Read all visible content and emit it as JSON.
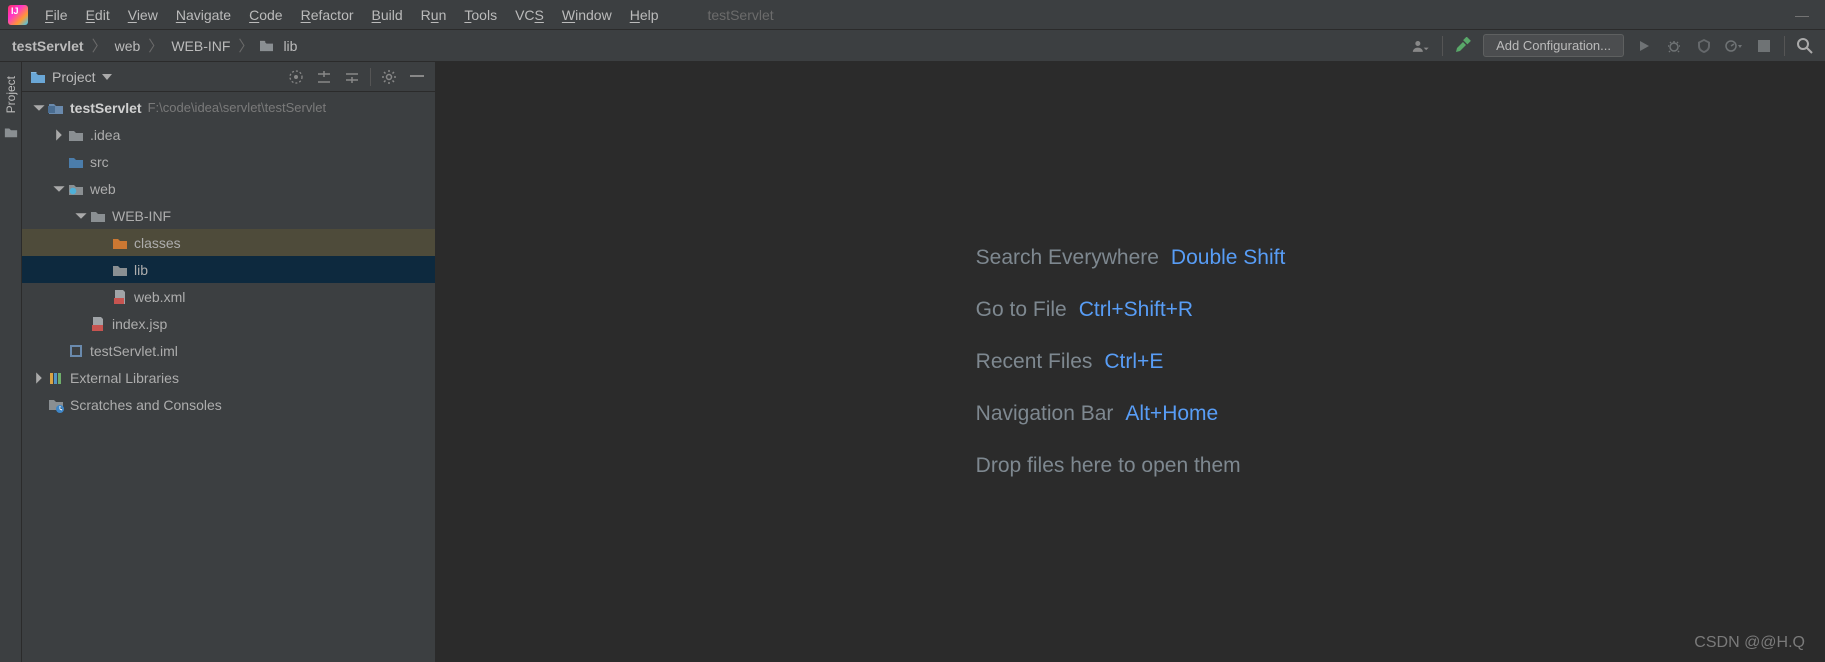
{
  "menubar": {
    "items": [
      {
        "u": "F",
        "rest": "ile"
      },
      {
        "u": "E",
        "rest": "dit"
      },
      {
        "u": "V",
        "rest": "iew"
      },
      {
        "u": "N",
        "rest": "avigate"
      },
      {
        "u": "C",
        "rest": "ode"
      },
      {
        "u": "R",
        "rest": "efactor"
      },
      {
        "u": "B",
        "rest": "uild"
      },
      {
        "u": "R",
        "pre": "",
        "rest": "u",
        "u2": "n",
        "rest2": ""
      },
      {
        "u": "T",
        "rest": "ools"
      },
      {
        "plain": "VC",
        "u": "S",
        "rest": ""
      },
      {
        "u": "W",
        "rest": "indow"
      },
      {
        "u": "H",
        "rest": "elp"
      }
    ],
    "title": "testServlet"
  },
  "breadcrumbs": [
    "testServlet",
    "web",
    "WEB-INF",
    "lib"
  ],
  "navbar": {
    "add_config": "Add Configuration..."
  },
  "gutter": {
    "label": "Project"
  },
  "pane": {
    "title": "Project"
  },
  "tree": {
    "root": {
      "label": "testServlet",
      "hint": "F:\\code\\idea\\servlet\\testServlet"
    },
    "idea": ".idea",
    "src": "src",
    "web": "web",
    "webinf": "WEB-INF",
    "classes": "classes",
    "lib": "lib",
    "webxml": "web.xml",
    "indexjsp": "index.jsp",
    "iml": "testServlet.iml",
    "extlib": "External Libraries",
    "scratches": "Scratches and Consoles"
  },
  "tips": {
    "rows": [
      {
        "label": "Search Everywhere",
        "shortcut": "Double Shift"
      },
      {
        "label": "Go to File",
        "shortcut": "Ctrl+Shift+R"
      },
      {
        "label": "Recent Files",
        "shortcut": "Ctrl+E"
      },
      {
        "label": "Navigation Bar",
        "shortcut": "Alt+Home"
      }
    ],
    "drop": "Drop files here to open them"
  },
  "watermark": "CSDN @@H.Q"
}
